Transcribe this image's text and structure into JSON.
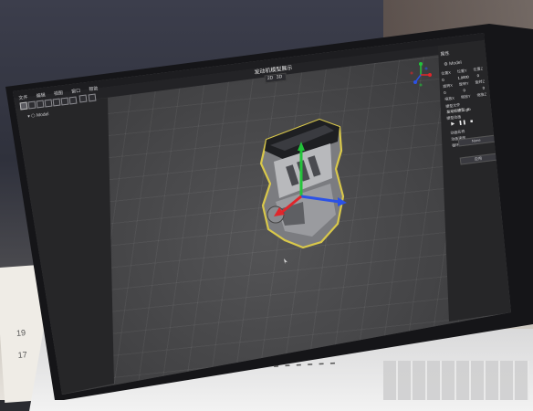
{
  "app": {
    "title": "发动机模型展示",
    "view_mode": {
      "option_2d": "2D",
      "option_3d": "3D"
    }
  },
  "toolbar": {
    "menu_items": [
      "文件",
      "编辑",
      "视图",
      "窗口",
      "帮助"
    ],
    "tools": [
      "select-icon",
      "move-icon",
      "rotate-icon",
      "scale-icon",
      "fit-icon",
      "snap-icon",
      "delete-icon",
      "camera-icon",
      "frame-icon"
    ]
  },
  "hierarchy": {
    "root_label": "Model"
  },
  "inspector": {
    "header": "属性",
    "object_name": "Model",
    "sections": [
      {
        "label": "位置",
        "fields": [
          "位置X",
          "位置Y",
          "位置Z"
        ],
        "values": [
          "0",
          "1.0000",
          "0"
        ]
      },
      {
        "label": "旋转",
        "fields": [
          "旋转X",
          "旋转Y",
          "旋转Z"
        ],
        "values": [
          "0",
          "0",
          "0"
        ]
      },
      {
        "label": "缩放",
        "fields": [
          "缩放X",
          "缩放Y",
          "缩放Z"
        ],
        "values": [
          "1",
          "1",
          "1"
        ]
      }
    ],
    "model_file_label": "模型文件",
    "model_file_value": "发动机模型.glb",
    "animation_label": "模型动画",
    "animation_controls": [
      "play-icon",
      "pause-icon",
      "stop-icon"
    ],
    "anim_fields": [
      "动画名称",
      "动画速度",
      "循环播放"
    ],
    "anim_dropdown": "None",
    "apply_button": "应用"
  },
  "colors": {
    "axis_x": "#e0262b",
    "axis_y": "#23c33a",
    "axis_z": "#2b52e6",
    "selection_outline": "#d9c84a",
    "accent": "#4f8cff"
  }
}
